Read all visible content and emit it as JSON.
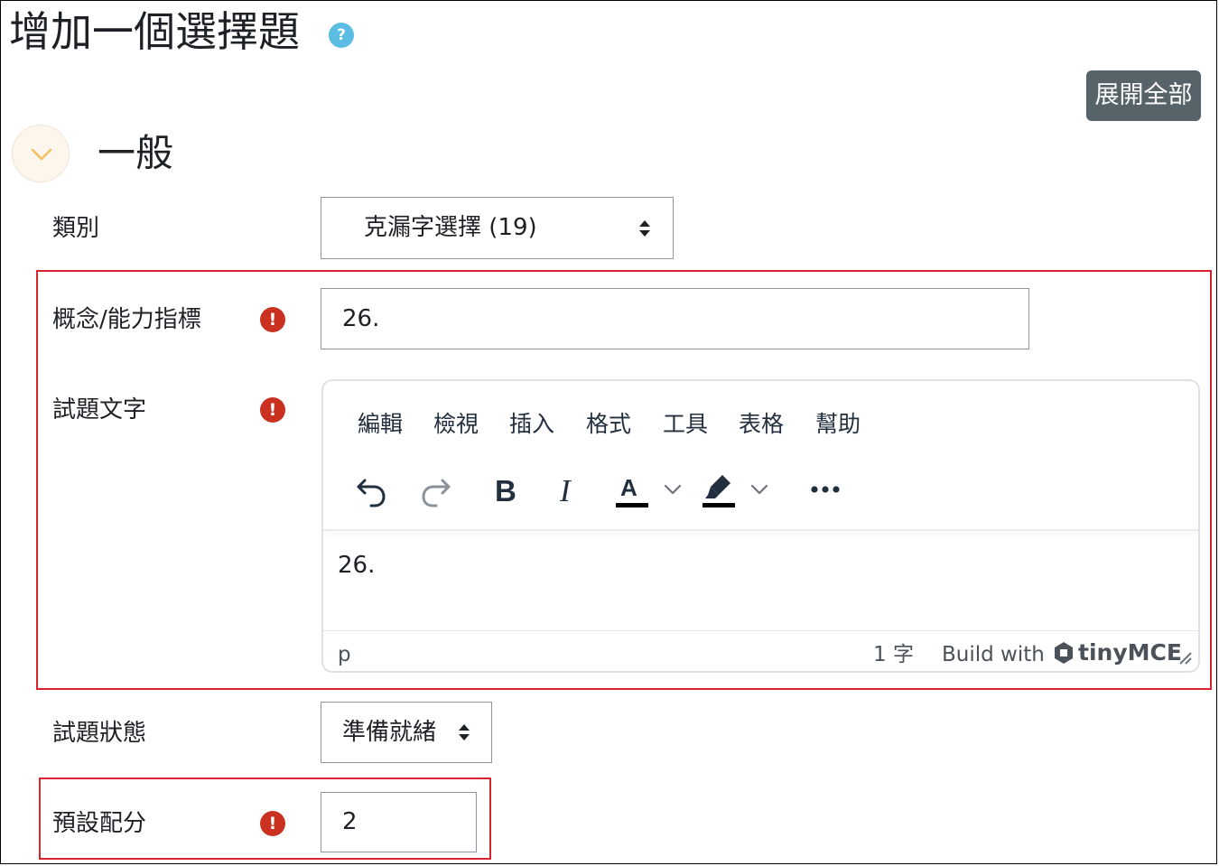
{
  "page": {
    "title": "增加一個選擇題",
    "help_glyph": "?"
  },
  "actions": {
    "expand_all": "展開全部"
  },
  "section": {
    "title": "一般"
  },
  "fields": {
    "category": {
      "label": "類別",
      "value": "克漏字選擇 (19)"
    },
    "concept": {
      "label": "概念/能力指標",
      "value": "26.",
      "required_glyph": "!"
    },
    "question_text": {
      "label": "試題文字",
      "required_glyph": "!"
    },
    "status": {
      "label": "試題狀態",
      "value": "準備就緒"
    },
    "default_mark": {
      "label": "預設配分",
      "value": "2",
      "required_glyph": "!"
    }
  },
  "editor": {
    "menubar": [
      "編輯",
      "檢視",
      "插入",
      "格式",
      "工具",
      "表格",
      "幫助"
    ],
    "toolbar_icons": [
      "undo-icon",
      "redo-icon",
      "bold-icon",
      "italic-icon",
      "text-color-icon",
      "chevron-down-icon",
      "highlight-color-icon",
      "chevron-down-icon",
      "more-icon"
    ],
    "bold_glyph": "B",
    "italic_glyph": "I",
    "text_color_glyph": "A",
    "content": "26.",
    "status_path": "p",
    "word_count": "1 字",
    "branding_prefix": "Build with",
    "branding_name": "tinyMCE"
  },
  "colors": {
    "required": "#ca3120",
    "help": "#5bbde4",
    "highlight_border": "#d9232e",
    "button": "#566369"
  }
}
